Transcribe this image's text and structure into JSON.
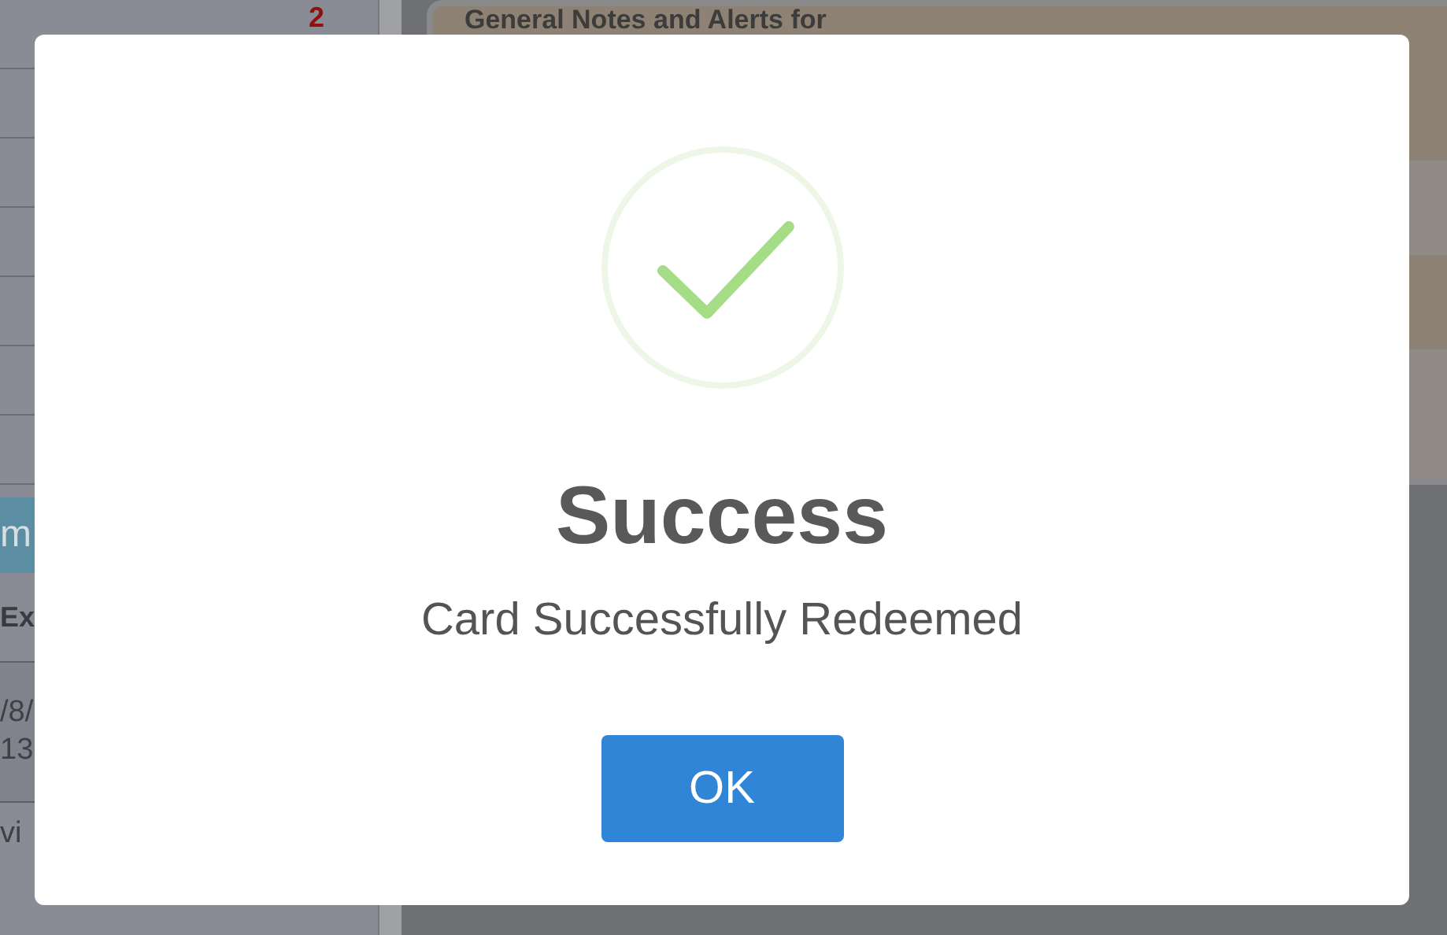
{
  "background": {
    "counter": "2",
    "tab": "m",
    "column_header": "Ex",
    "cell_lines": [
      "/8/",
      "13"
    ],
    "footer_text": "vi",
    "notes_title": "General Notes and Alerts for"
  },
  "dialog": {
    "title": "Success",
    "message": "Card Successfully Redeemed",
    "buttons": [
      {
        "label": "OK"
      }
    ]
  }
}
